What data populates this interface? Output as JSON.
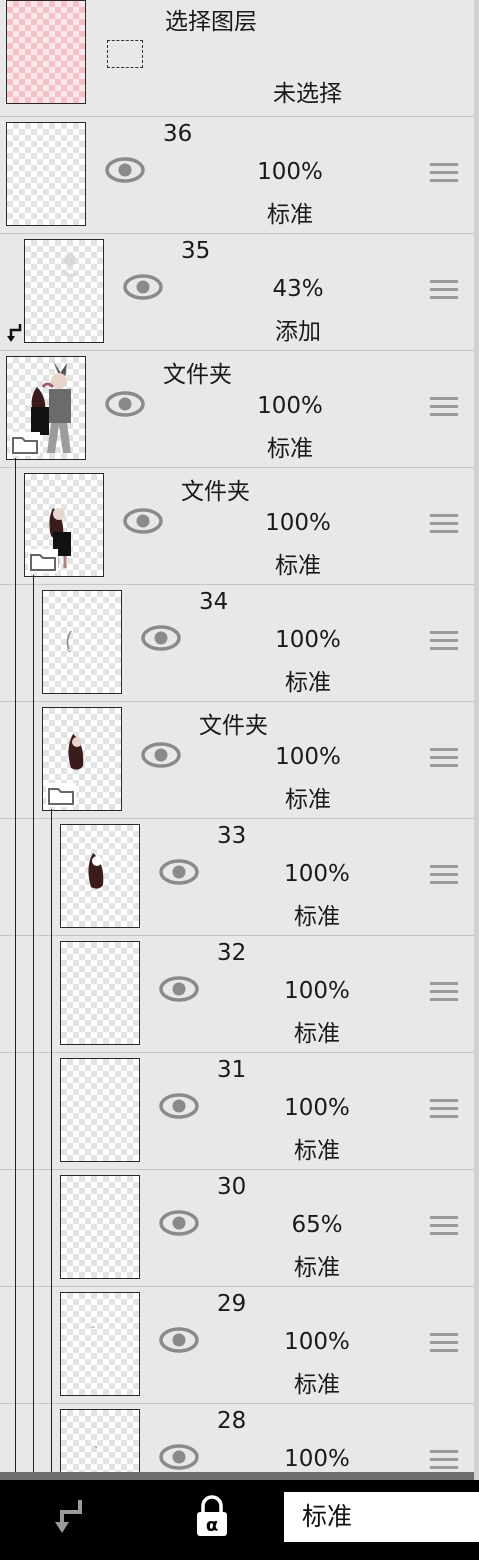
{
  "selection_layer": {
    "title": "选择图层",
    "status": "未选择"
  },
  "layers": [
    {
      "name": "36",
      "opacity": "100%",
      "blend": "标准"
    },
    {
      "name": "35",
      "opacity": "43%",
      "blend": "添加"
    },
    {
      "name": "文件夹",
      "opacity": "100%",
      "blend": "标准"
    },
    {
      "name": "文件夹",
      "opacity": "100%",
      "blend": "标准"
    },
    {
      "name": "34",
      "opacity": "100%",
      "blend": "标准"
    },
    {
      "name": "文件夹",
      "opacity": "100%",
      "blend": "标准"
    },
    {
      "name": "33",
      "opacity": "100%",
      "blend": "标准"
    },
    {
      "name": "32",
      "opacity": "100%",
      "blend": "标准"
    },
    {
      "name": "31",
      "opacity": "100%",
      "blend": "标准"
    },
    {
      "name": "30",
      "opacity": "65%",
      "blend": "标准"
    },
    {
      "name": "29",
      "opacity": "100%",
      "blend": "标准"
    },
    {
      "name": "28",
      "opacity": "100%",
      "blend": ""
    }
  ],
  "toolbar": {
    "clip_icon": "clipping-arrow-icon",
    "lock_icon": "alpha-lock-icon",
    "blend_mode": "标准"
  },
  "colors": {
    "panel_bg": "#e8e8e8",
    "toolbar_bg": "#000000",
    "eye_gray": "#8a8a8a"
  }
}
